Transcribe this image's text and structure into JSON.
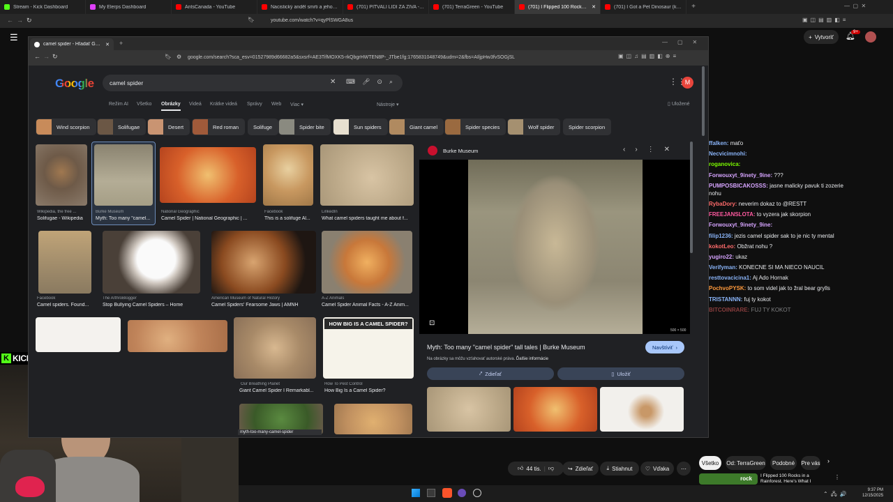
{
  "outer_tabs": [
    {
      "label": "Stream - Kick Dashboard",
      "color": "#53fc18"
    },
    {
      "label": "My Elerps Dashboard",
      "color": "#e040fb"
    },
    {
      "label": "AntsCanada - YouTube",
      "color": "#ff0000"
    },
    {
      "label": "Nacistický anděl smrti a jeho strašliv",
      "color": "#ff0000"
    },
    {
      "label": "(701) PITVALI LIDI ZA ŽIVA - šokující",
      "color": "#ff0000"
    },
    {
      "label": "(701) TerraGreen - YouTube",
      "color": "#ff0000"
    },
    {
      "label": "(701) I Flipped 100 Rocks at Nig",
      "color": "#ff0000"
    },
    {
      "label": "(701) I Got a Pet Dinosaur (kinda)",
      "color": "#ff0000"
    }
  ],
  "outer_url": "youtube.com/watch?v=qyPlSWGA8us",
  "youtube": {
    "create_label": "Vytvoriť",
    "notif_count": "9+",
    "likes": "44 tis.",
    "share": "Zdieľať",
    "download": "Stiahnut",
    "thanks": "Vďaka",
    "filters": [
      "Všetko",
      "Od: TerraGreen",
      "Podobné",
      "Pre vás"
    ],
    "rec_title": "I Flipped 100 Rocks in a Rainforest. Here's What I",
    "rec_thumb_text": "rock"
  },
  "kick_label": "KICK.COM/RESTT",
  "chat": [
    {
      "user": "ffalken:",
      "msg": "maťo",
      "color": "#8ab4f8"
    },
    {
      "user": "Necvicimnohi:",
      "msg": "",
      "color": "#8ab4f8"
    },
    {
      "user": "roganovica:",
      "msg": "",
      "color": "#7cfc00"
    },
    {
      "user": "Forwouxyt_9inety_9ine:",
      "msg": "???",
      "color": "#d6a4ff"
    },
    {
      "user": "PUMPOSBICAKOSSS:",
      "msg": "jasne malicky pavuk ti zozerie nohu",
      "color": "#d6a4ff"
    },
    {
      "user": "RybaDory:",
      "msg": "neverim dokaz to @RESTT",
      "color": "#ff6b6b"
    },
    {
      "user": "FREEJANSLOTA:",
      "msg": "to vyzera jak skorpion",
      "color": "#ff5aa0"
    },
    {
      "user": "Forwouxyt_9inety_9ine:",
      "msg": "",
      "color": "#d6a4ff"
    },
    {
      "user": "filip1236:",
      "msg": "jezis camel spider sak to je nic ty mental",
      "color": "#8ab4f8"
    },
    {
      "user": "kokotLeo:",
      "msg": "Obžrat nohu ?",
      "color": "#ff6b6b"
    },
    {
      "user": "yugiro22:",
      "msg": "ukaz",
      "color": "#d6a4ff"
    },
    {
      "user": "Verifyman:",
      "msg": "KONECNE SI MA NIECO NAUCIL",
      "color": "#8ab4f8"
    },
    {
      "user": "resttovacicina1:",
      "msg": "Aj Ado Hornak",
      "color": "#8ab4f8"
    },
    {
      "user": "PochvoPYSK:",
      "msg": "to som videl jak to žral bear grylls",
      "color": "#ff9a3c"
    },
    {
      "user": "TRISTANNN:",
      "msg": "fuj ty kokot",
      "color": "#8ab4f8"
    },
    {
      "user": "BITCOINRARE:",
      "msg": "FUJ TY KOKOT",
      "color": "#ff6b6b"
    }
  ],
  "inner": {
    "tab_title": "camel spider - Hľadať Googlom",
    "url": "google.com/search?sca_esv=01527989d66682a5&sxsrf=AE3TifMOXK5-rkQbgrHWTEN8P-_JTbe1fg:1765831048749&udm=2&fbs=AIljpHw3fvSOGjSL"
  },
  "google": {
    "logo": "Google",
    "query": "camel spider",
    "nav": [
      "Režim AI",
      "Všetko",
      "Obrázky",
      "Videá",
      "Krátke videá",
      "Správy",
      "Web",
      "Viac"
    ],
    "tools": "Nástroje",
    "saved": "Uložené",
    "avatar": "M",
    "chips": [
      "Wind scorpion",
      "Solifugae",
      "Desert",
      "Red roman",
      "Solifuge",
      "Spider bite",
      "Sun spiders",
      "Giant camel",
      "Spider species",
      "Wolf spider",
      "Spider scorpion"
    ],
    "results": [
      {
        "src": "Wikipedia, the free ...",
        "title": "Solifugae - Wikipedia"
      },
      {
        "src": "Burke Museum",
        "title": "Myth: Too many \"camel..."
      },
      {
        "src": "National Geographic",
        "title": "Camel Spider | National Geographic | ..."
      },
      {
        "src": "Facebook",
        "title": "This is a solifuge Al..."
      },
      {
        "src": "LinkedIn",
        "title": "What camel spiders taught me about f..."
      },
      {
        "src": "Facebook",
        "title": "Camel spiders. Found..."
      },
      {
        "src": "The ArthroBlogger",
        "title": "Stop Bullying Camel Spiders – Home"
      },
      {
        "src": "American Museum of Natural History",
        "title": "Camel Spiders' Fearsome Jaws | AMNH"
      },
      {
        "src": "A-Z Animals",
        "title": "Camel Spider Animal Facts - A-Z Anim..."
      },
      {
        "src": "Our Breathing Planet",
        "title": "Giant Camel Spider I Remarkabl..."
      },
      {
        "src": "How To Pest Control",
        "title": "How Big Is a Camel Spider?"
      }
    ],
    "infographic_title": "HOW BIG IS A CAMEL SPIDER?",
    "hover_url": "myth-too-many-camel-spider"
  },
  "panel": {
    "source": "Burke Museum",
    "dims": "500 × 500",
    "title": "Myth: Too many \"camel spider\" tall tales | Burke Museum",
    "visit": "Navštíviť",
    "notice": "Na obrázky sa môžu vzťahovať autorské práva.",
    "more": "Ďalšie informácie",
    "share": "Zdieľať",
    "save": "Uložiť"
  },
  "clock": {
    "time": "9:37 PM",
    "date": "12/15/2025"
  }
}
